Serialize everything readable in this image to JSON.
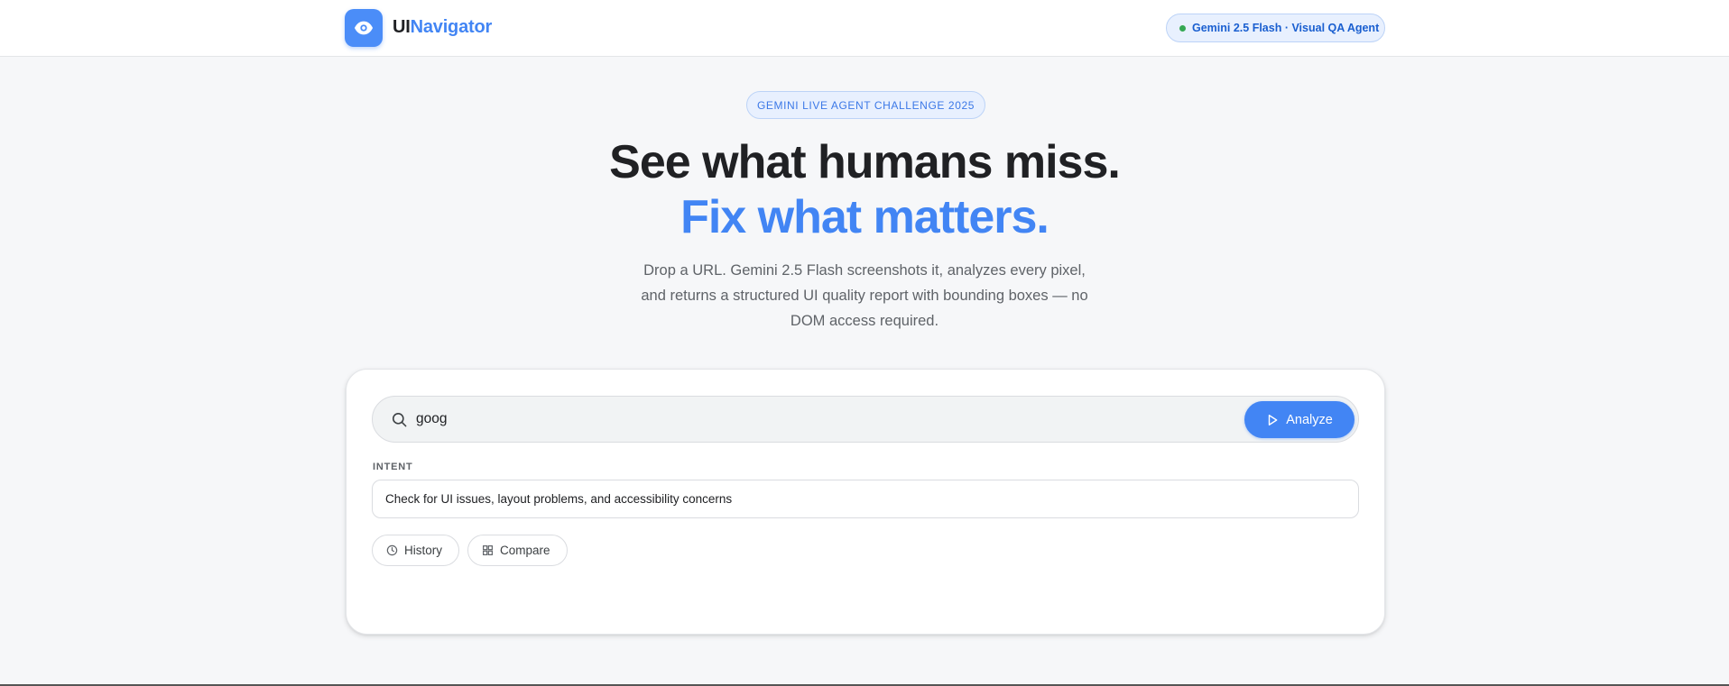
{
  "header": {
    "brand_part1": "UI",
    "brand_part2": "Navigator",
    "logo_icon": "eye-icon",
    "model_badge": "Gemini 2.5 Flash · Visual QA Agent",
    "status_color": "#34a853"
  },
  "hero": {
    "badge": "GEMINI LIVE AGENT CHALLENGE 2025",
    "headline_line1": "See what humans miss.",
    "headline_line2": "Fix what matters.",
    "description": "Drop a URL. Gemini 2.5 Flash screenshots it, analyzes every pixel, and returns a structured UI quality report with bounding boxes — no DOM access required."
  },
  "form": {
    "search_icon": "search-icon",
    "url_value": "goog",
    "analyze_label": "Analyze",
    "analyze_icon": "play-icon",
    "intent_label": "INTENT",
    "intent_value": "Check for UI issues, layout problems, and accessibility concerns",
    "history_label": "History",
    "history_icon": "clock-icon",
    "compare_label": "Compare",
    "compare_icon": "grid-icon"
  },
  "colors": {
    "accent": "#4285f4",
    "background": "#f6f7f9",
    "text": "#202124"
  }
}
